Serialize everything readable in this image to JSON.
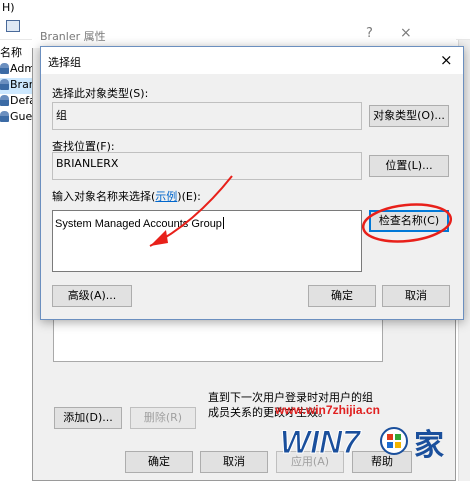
{
  "background": {
    "top_menu": "H)",
    "list_header": "名称",
    "users": [
      "Admi",
      "Branl",
      "Defa",
      "Gues"
    ]
  },
  "properties_dialog": {
    "title": "Branler 属性",
    "help": "?",
    "close": "×",
    "note": "直到下一次用户登录时对用户的组成员关系的更改才生效。",
    "add_button": "添加(D)...",
    "remove_button": "删除(R)",
    "ok_button": "确定",
    "cancel_button": "取消",
    "apply_button": "应用(A)",
    "help_button": "帮助"
  },
  "select_group_dialog": {
    "title": "选择组",
    "close": "×",
    "object_type_label": "选择此对象类型(S):",
    "object_type_value": "组",
    "object_type_button": "对象类型(O)...",
    "location_label": "查找位置(F):",
    "location_value": "BRIANLERX",
    "location_button": "位置(L)...",
    "object_name_label_prefix": "输入对象名称来选择(",
    "object_name_label_link": "示例",
    "object_name_label_suffix": ")(E):",
    "object_name_value": "System Managed Accounts Group",
    "check_names_button": "检查名称(C)",
    "advanced_button": "高级(A)...",
    "ok_button": "确定",
    "cancel_button": "取消"
  },
  "watermark": {
    "url": "www.win7zhijia.cn",
    "logo_text": "WIN7",
    "logo_suffix": "家"
  },
  "colors": {
    "annotation_red": "#e8201a",
    "link_blue": "#0066cc",
    "focus_blue": "#0078d7"
  }
}
